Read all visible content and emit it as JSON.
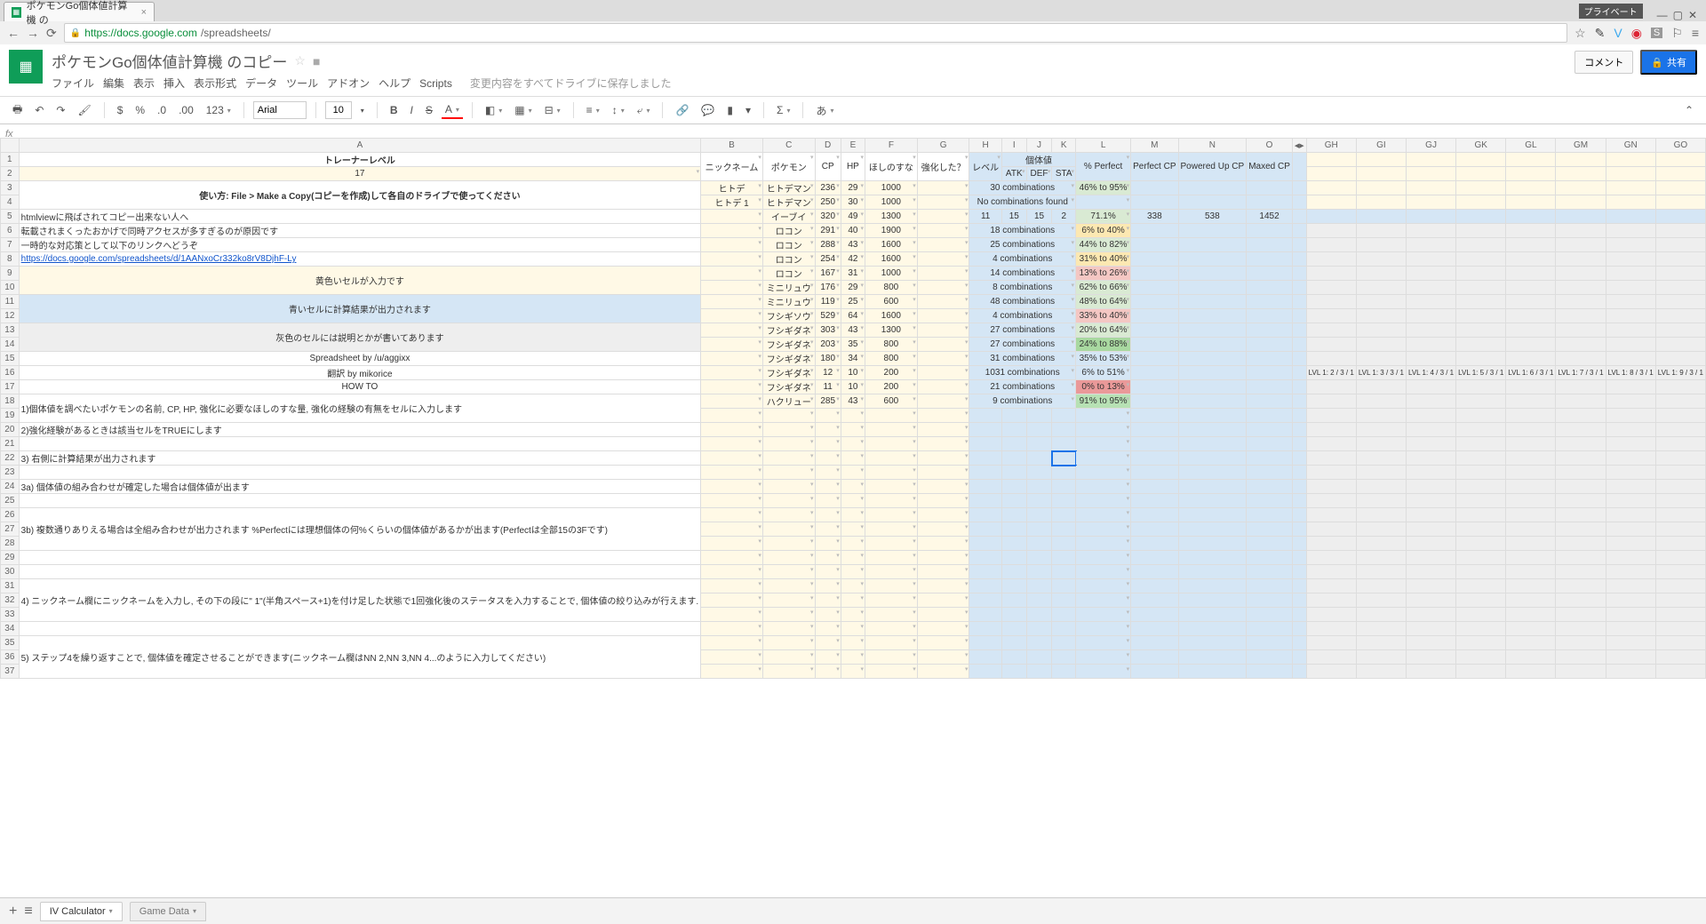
{
  "browser": {
    "tab_title": "ポケモンGo個体値計算機 の",
    "private_label": "プライベート",
    "url_host": "https://docs.google.com",
    "url_path": "/spreadsheets/"
  },
  "doc": {
    "title": "ポケモンGo個体値計算機 のコピー",
    "menus": [
      "ファイル",
      "編集",
      "表示",
      "挿入",
      "表示形式",
      "データ",
      "ツール",
      "アドオン",
      "ヘルプ",
      "Scripts"
    ],
    "save_status": "変更内容をすべてドライブに保存しました",
    "comment_btn": "コメント",
    "share_btn": "共有"
  },
  "toolbar": {
    "currency": "$",
    "percent": "%",
    "dec_dec": ".0",
    "dec_inc": ".00",
    "numfmt": "123",
    "font": "Arial",
    "size": "10",
    "bold": "B",
    "italic": "I",
    "strike": "S",
    "textcolor": "A",
    "more": "…"
  },
  "cols": [
    "A",
    "B",
    "C",
    "D",
    "E",
    "F",
    "G",
    "H",
    "I",
    "J",
    "K",
    "L",
    "M",
    "N",
    "O",
    "",
    "GH",
    "GI",
    "GJ",
    "GK",
    "GL",
    "GM",
    "GN",
    "GO"
  ],
  "headers": {
    "trainer_level": "トレーナーレベル",
    "trainer_level_val": "17",
    "nickname": "ニックネーム",
    "pokemon": "ポケモン",
    "cp": "CP",
    "hp": "HP",
    "stardust": "ほしのすな",
    "powered": "強化した？",
    "level": "レベル",
    "iv": "個体値",
    "atk": "ATK",
    "def": "DEF",
    "sta": "STA",
    "pct": "% Perfect",
    "pcp": "Perfect CP",
    "ucp": "Powered Up CP",
    "mcp": "Maxed CP"
  },
  "notes": {
    "usage": "使い方: File > Make a Copy(コピーを作成)して各自のドライブで使ってください",
    "n5": "htmlviewに飛ばされてコピー出来ない人へ",
    "n6": "転載されまくったおかげで同時アクセスが多すぎるのが原因です",
    "n7": "一時的な対応策として以下のリンクへどうぞ",
    "n8": "https://docs.google.com/spreadsheets/d/1AANxoCr332ko8rV8DjhF-Ly",
    "n9_10": "黄色いセルが入力です",
    "n11_12": "青いセルに計算結果が出力されます",
    "n13_14": "灰色のセルには説明とかが書いてあります",
    "n15": "Spreadsheet by /u/aggixx",
    "n16": "翻訳 by mikorice",
    "n17": "HOW TO",
    "n18_19": "1)個体値を調べたいポケモンの名前, CP, HP, 強化に必要なほしのすな量, 強化の経験の有無をセルに入力します",
    "n20": "2)強化経験があるときは該当セルをTRUEにします",
    "n22": "3) 右側に計算結果が出力されます",
    "n24": "3a) 個体値の組み合わせが確定した場合は個体値が出ます",
    "n26_28": "3b) 複数通りありえる場合は全組み合わせが出力されます %Perfectには理想個体の何%くらいの個体値があるかが出ます(Perfectは全部15の3Fです)",
    "n31_33": "4) ニックネーム欄にニックネームを入力し, その下の段に\" 1\"(半角スペース+1)を付け足した状態で1回強化後のステータスを入力することで, 個体値の絞り込みが行えます.",
    "n35_37": "5) ステップ4を繰り返すことで, 個体値を確定させることができます(ニックネーム欄はNN 2,NN 3,NN 4...のように入力してください)"
  },
  "rows": [
    {
      "r": 3,
      "nick": "ヒトデ",
      "poke": "ヒトデマン",
      "cp": 236,
      "hp": 29,
      "dust": 1000,
      "combo": "30 combinations",
      "pct": "46% to 95%",
      "pcls": "pct-g2"
    },
    {
      "r": 4,
      "nick": "ヒトデ 1",
      "poke": "ヒトデマン",
      "cp": 250,
      "hp": 30,
      "dust": 1000,
      "combo": "No combinations found",
      "pct": "",
      "pcls": ""
    },
    {
      "r": 5,
      "nick": "",
      "poke": "イーブイ",
      "cp": 320,
      "hp": 49,
      "dust": 1300,
      "lvl": 11,
      "atk": 15,
      "def": 15,
      "sta": 2,
      "combo": "",
      "pct": "71.1%",
      "pcls": "pct-g2",
      "pcp": 338,
      "ucp": 538,
      "mcp": 1452
    },
    {
      "r": 6,
      "nick": "",
      "poke": "ロコン",
      "cp": 291,
      "hp": 40,
      "dust": 1900,
      "combo": "18 combinations",
      "pct": "6% to 40%",
      "pcls": "pct-y1"
    },
    {
      "r": 7,
      "nick": "",
      "poke": "ロコン",
      "cp": 288,
      "hp": 43,
      "dust": 1600,
      "combo": "25 combinations",
      "pct": "44% to 82%",
      "pcls": "pct-g2"
    },
    {
      "r": 8,
      "nick": "",
      "poke": "ロコン",
      "cp": 254,
      "hp": 42,
      "dust": 1600,
      "combo": "4 combinations",
      "pct": "31% to 40%",
      "pcls": "pct-y1"
    },
    {
      "r": 9,
      "nick": "",
      "poke": "ロコン",
      "cp": 167,
      "hp": 31,
      "dust": 1000,
      "combo": "14 combinations",
      "pct": "13% to 26%",
      "pcls": "pct-r1"
    },
    {
      "r": 10,
      "nick": "",
      "poke": "ミニリュウ",
      "cp": 176,
      "hp": 29,
      "dust": 800,
      "combo": "8 combinations",
      "pct": "62% to 66%",
      "pcls": "pct-g2"
    },
    {
      "r": 11,
      "nick": "",
      "poke": "ミニリュウ",
      "cp": 119,
      "hp": 25,
      "dust": 600,
      "combo": "48 combinations",
      "pct": "48% to 64%",
      "pcls": "pct-g2"
    },
    {
      "r": 12,
      "nick": "",
      "poke": "フシギソウ",
      "cp": 529,
      "hp": 64,
      "dust": 1600,
      "combo": "4 combinations",
      "pct": "33% to 40%",
      "pcls": "pct-r1"
    },
    {
      "r": 13,
      "nick": "",
      "poke": "フシギダネ",
      "cp": 303,
      "hp": 43,
      "dust": 1300,
      "combo": "27 combinations",
      "pct": "20% to 64%",
      "pcls": "pct-g2"
    },
    {
      "r": 14,
      "nick": "",
      "poke": "フシギダネ",
      "cp": 203,
      "hp": 35,
      "dust": 800,
      "combo": "27 combinations",
      "pct": "24% to 88%",
      "pcls": "pct-g3"
    },
    {
      "r": 15,
      "nick": "",
      "poke": "フシギダネ",
      "cp": 180,
      "hp": 34,
      "dust": 800,
      "combo": "31 combinations",
      "pct": "35% to 53%",
      "pcls": ""
    },
    {
      "r": 16,
      "nick": "",
      "poke": "フシギダネ",
      "cp": 12,
      "hp": 10,
      "dust": 200,
      "combo": "1031 combinations",
      "pct": "6% to 51%",
      "pcls": ""
    },
    {
      "r": 17,
      "nick": "",
      "poke": "フシギダネ",
      "cp": 11,
      "hp": 10,
      "dust": 200,
      "combo": "21 combinations",
      "pct": "0% to 13%",
      "pcls": "pct-r2"
    },
    {
      "r": 18,
      "nick": "",
      "poke": "ハクリュー",
      "cp": 285,
      "hp": 43,
      "dust": 600,
      "combo": "9 combinations",
      "pct": "91% to 95%",
      "pcls": "pct-g1"
    }
  ],
  "lvl_row16": [
    "LVL 1: 2 / 3 / 1",
    "LVL 1: 3 / 3 / 1",
    "LVL 1: 4 / 3 / 1",
    "LVL 1: 5 / 3 / 1",
    "LVL 1: 6 / 3 / 1",
    "LVL 1: 7 / 3 / 1",
    "LVL 1: 8 / 3 / 1",
    "LVL 1: 9 / 3 / 1"
  ],
  "sheets": {
    "active": "IV Calculator",
    "other": "Game Data"
  }
}
